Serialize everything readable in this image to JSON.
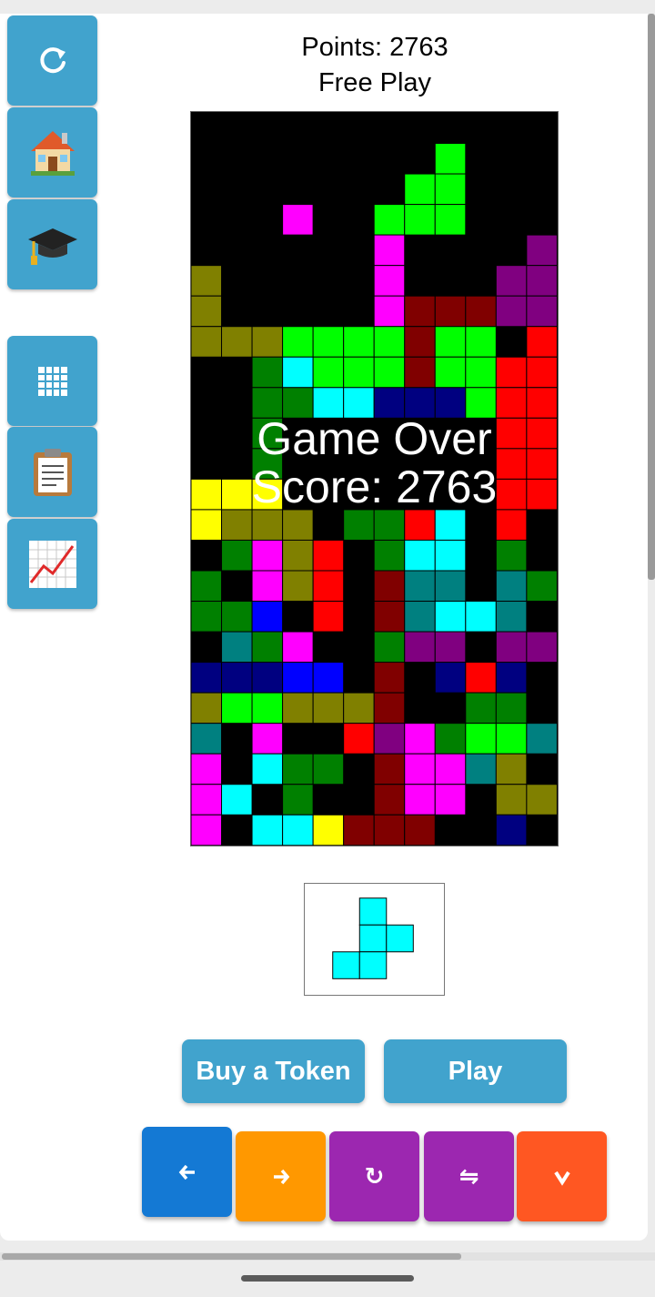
{
  "header": {
    "points": "Points: 2763",
    "mode": "Free Play"
  },
  "sidebar": {
    "top_group": [
      {
        "name": "restart-icon",
        "glyph": "⟳"
      },
      {
        "name": "home-icon",
        "glyph": "🏠"
      },
      {
        "name": "graduation-cap-icon",
        "glyph": "🎓"
      }
    ],
    "bottom_group": [
      {
        "name": "grid-icon",
        "glyph": "▦"
      },
      {
        "name": "clipboard-icon",
        "glyph": "📋"
      },
      {
        "name": "chart-icon",
        "glyph": "📈"
      }
    ]
  },
  "game": {
    "over_text": "Game Over",
    "score_text": "Score: 2763",
    "palette": {
      ".": "#000000",
      "O": "#808000",
      "G": "#00ff00",
      "g": "#008000",
      "P": "#ff00ff",
      "M": "#800080",
      "R": "#ff0000",
      "r": "#800000",
      "C": "#00ffff",
      "T": "#008080",
      "N": "#000080",
      "B": "#0000ff",
      "Y": "#ffff00"
    },
    "rows": [
      "............",
      "........G...",
      ".......GG...",
      "...P..GGG...",
      "......P....M",
      "O.....P...MM",
      "O.....PrrrMM.",
      "OOOGGGGrGG.R",
      "..gCGGGrGGRRR",
      "..ggCCNNNGRR.",
      "..g.......RR",
      "..g.......RR",
      "YYY.......RR",
      "YOOO.ggRC.R.",
      ".gPOR.gCC.g.",
      "g.POR.rTT.Tg",
      "ggB.R.rTCCT.",
      ".TgP..gMM.MM",
      "NNNBB.r.NRN.",
      "OGGOOOr..gg.",
      "T.P..RMPgGGT",
      "P.Cgg.rPPTO.",
      "PC.g..rPP.OOO",
      "P.CCYrrr..N.N"
    ]
  },
  "preview": {
    "piece_color": "#00ffff",
    "cells": [
      [
        1,
        0
      ],
      [
        1,
        1
      ],
      [
        2,
        1
      ],
      [
        0,
        2
      ],
      [
        1,
        2
      ]
    ]
  },
  "actions": {
    "buy_token": "Buy a Token",
    "play": "Play"
  },
  "controls": [
    {
      "name": "move-left-button",
      "glyph": "🡐",
      "color": "#1479d4"
    },
    {
      "name": "move-right-button",
      "glyph": "🡒",
      "color": "#ff9800"
    },
    {
      "name": "rotate-button",
      "glyph": "↻",
      "color": "#9c27b0"
    },
    {
      "name": "flip-button",
      "glyph": "⇋",
      "color": "#9c27b0"
    },
    {
      "name": "drop-button",
      "glyph": "∨",
      "color": "#ff5722"
    }
  ]
}
